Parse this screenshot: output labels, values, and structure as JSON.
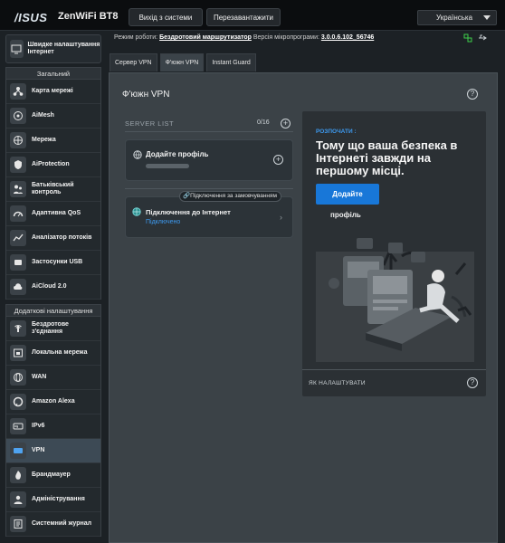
{
  "header": {
    "brand": "/ISUS",
    "model": "ZenWiFi BT8",
    "logout_label": "Вихід з системи",
    "reboot_label": "Перезавантажити",
    "language": "Українська"
  },
  "status": {
    "mode_label": "Режим роботи:",
    "mode_value": "Бездротовий маршрутизатор",
    "firmware_label": "Версія мікропрограми:",
    "firmware_value": "3.0.0.6.102_56746"
  },
  "sidebar": {
    "quick_setup": "Швидке налаштування Інтернет",
    "general_title": "Загальний",
    "general_items": [
      {
        "label": "Карта мережі",
        "icon": "network-map-icon"
      },
      {
        "label": "AiMesh",
        "icon": "aimesh-icon"
      },
      {
        "label": "Мережа",
        "icon": "network-icon"
      },
      {
        "label": "AiProtection",
        "icon": "aiprotection-icon"
      },
      {
        "label": "Батьківський контроль",
        "icon": "parental-control-icon"
      },
      {
        "label": "Адаптивна QoS",
        "icon": "qos-icon"
      },
      {
        "label": "Аналізатор потоків",
        "icon": "traffic-analyzer-icon"
      },
      {
        "label": "Застосунки USB",
        "icon": "usb-icon"
      },
      {
        "label": "AiCloud 2.0",
        "icon": "aicloud-icon"
      }
    ],
    "advanced_title": "Додаткові налаштування",
    "advanced_items": [
      {
        "label": "Бездротове з'єднання",
        "icon": "wireless-icon"
      },
      {
        "label": "Локальна мережа",
        "icon": "lan-icon"
      },
      {
        "label": "WAN",
        "icon": "wan-icon"
      },
      {
        "label": "Amazon Alexa",
        "icon": "alexa-icon"
      },
      {
        "label": "IPv6",
        "icon": "ipv6-icon"
      },
      {
        "label": "VPN",
        "icon": "vpn-icon"
      },
      {
        "label": "Брандмауер",
        "icon": "firewall-icon"
      },
      {
        "label": "Адміністрування",
        "icon": "admin-icon"
      },
      {
        "label": "Системний журнал",
        "icon": "syslog-icon"
      }
    ]
  },
  "tabs": [
    "Сервер VPN",
    "Ф'южн VPN",
    "Instant Guard"
  ],
  "main": {
    "title": "Ф'южн VPN",
    "server_list": "SERVER LIST",
    "server_count": "0/16",
    "add_profile": "Додайте профіль",
    "default_badge": "Підключення за замовчуванням",
    "internet_title": "Підключення до Інтернет",
    "internet_status": "Підключено"
  },
  "promo": {
    "kicker": "РОЗПОЧАТИ :",
    "headline": "Тому що ваша безпека в Інтернеті завжди на першому місці.",
    "cta": "Додайте",
    "profile": "профіль",
    "howto": "ЯК НАЛАШТУВАТИ"
  },
  "colors": {
    "accent": "#1877d8",
    "link": "#3d9af0",
    "panel": "#3b4247"
  }
}
